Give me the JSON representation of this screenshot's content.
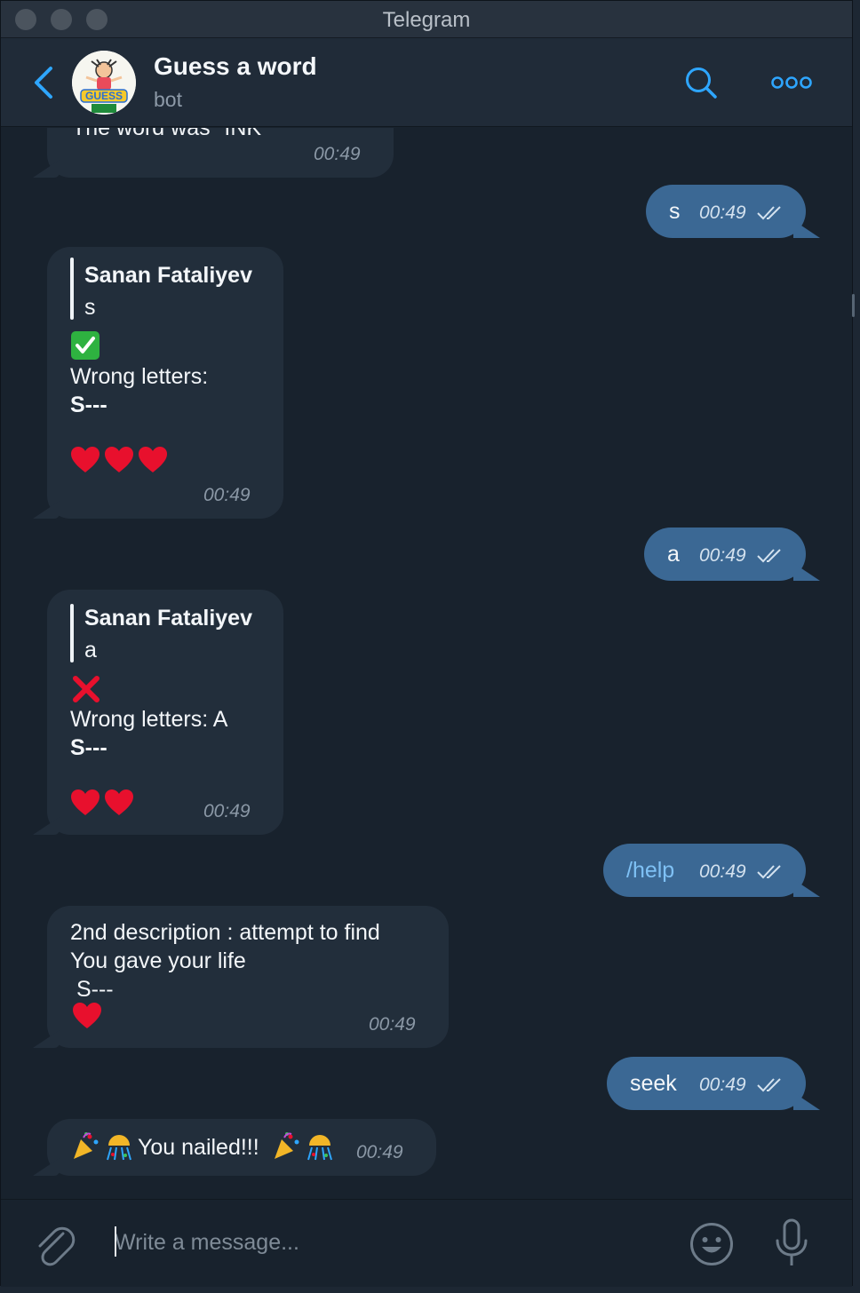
{
  "window": {
    "title": "Telegram"
  },
  "header": {
    "chat_title": "Guess a word",
    "chat_subtitle": "bot",
    "avatar_icon": "guess-a-word-bot-avatar"
  },
  "messages": [
    {
      "side": "in",
      "text": "The word was \"INK\"",
      "time": "00:49"
    },
    {
      "side": "out",
      "text": "s",
      "time": "00:49",
      "status": "read"
    },
    {
      "side": "in",
      "reply_author": "Sanan Fataliyev",
      "reply_text": "s",
      "status_icon": "check-mark",
      "lines": [
        "Wrong letters:",
        "S---"
      ],
      "hearts": 3,
      "time": "00:49"
    },
    {
      "side": "out",
      "text": "a",
      "time": "00:49",
      "status": "read"
    },
    {
      "side": "in",
      "reply_author": "Sanan Fataliyev",
      "reply_text": "a",
      "status_icon": "cross-mark",
      "lines": [
        "Wrong letters: A",
        "S---"
      ],
      "hearts": 2,
      "time": "00:49"
    },
    {
      "side": "out",
      "text": "/help",
      "time": "00:49",
      "status": "read"
    },
    {
      "side": "in",
      "lines": [
        "2nd description : attempt to find",
        "You gave your life",
        " S---"
      ],
      "hearts": 1,
      "time": "00:49"
    },
    {
      "side": "out",
      "text": "seek",
      "time": "00:49",
      "status": "read"
    },
    {
      "side": "in",
      "text": "You nailed!!!",
      "time": "00:49"
    }
  ],
  "composer": {
    "placeholder": "Write a message..."
  },
  "colors": {
    "background": "#18222d",
    "incoming_bubble": "#222e3b",
    "outgoing_bubble": "#3b6894",
    "accent": "#2ea6ff",
    "heart": "#e8102d"
  }
}
